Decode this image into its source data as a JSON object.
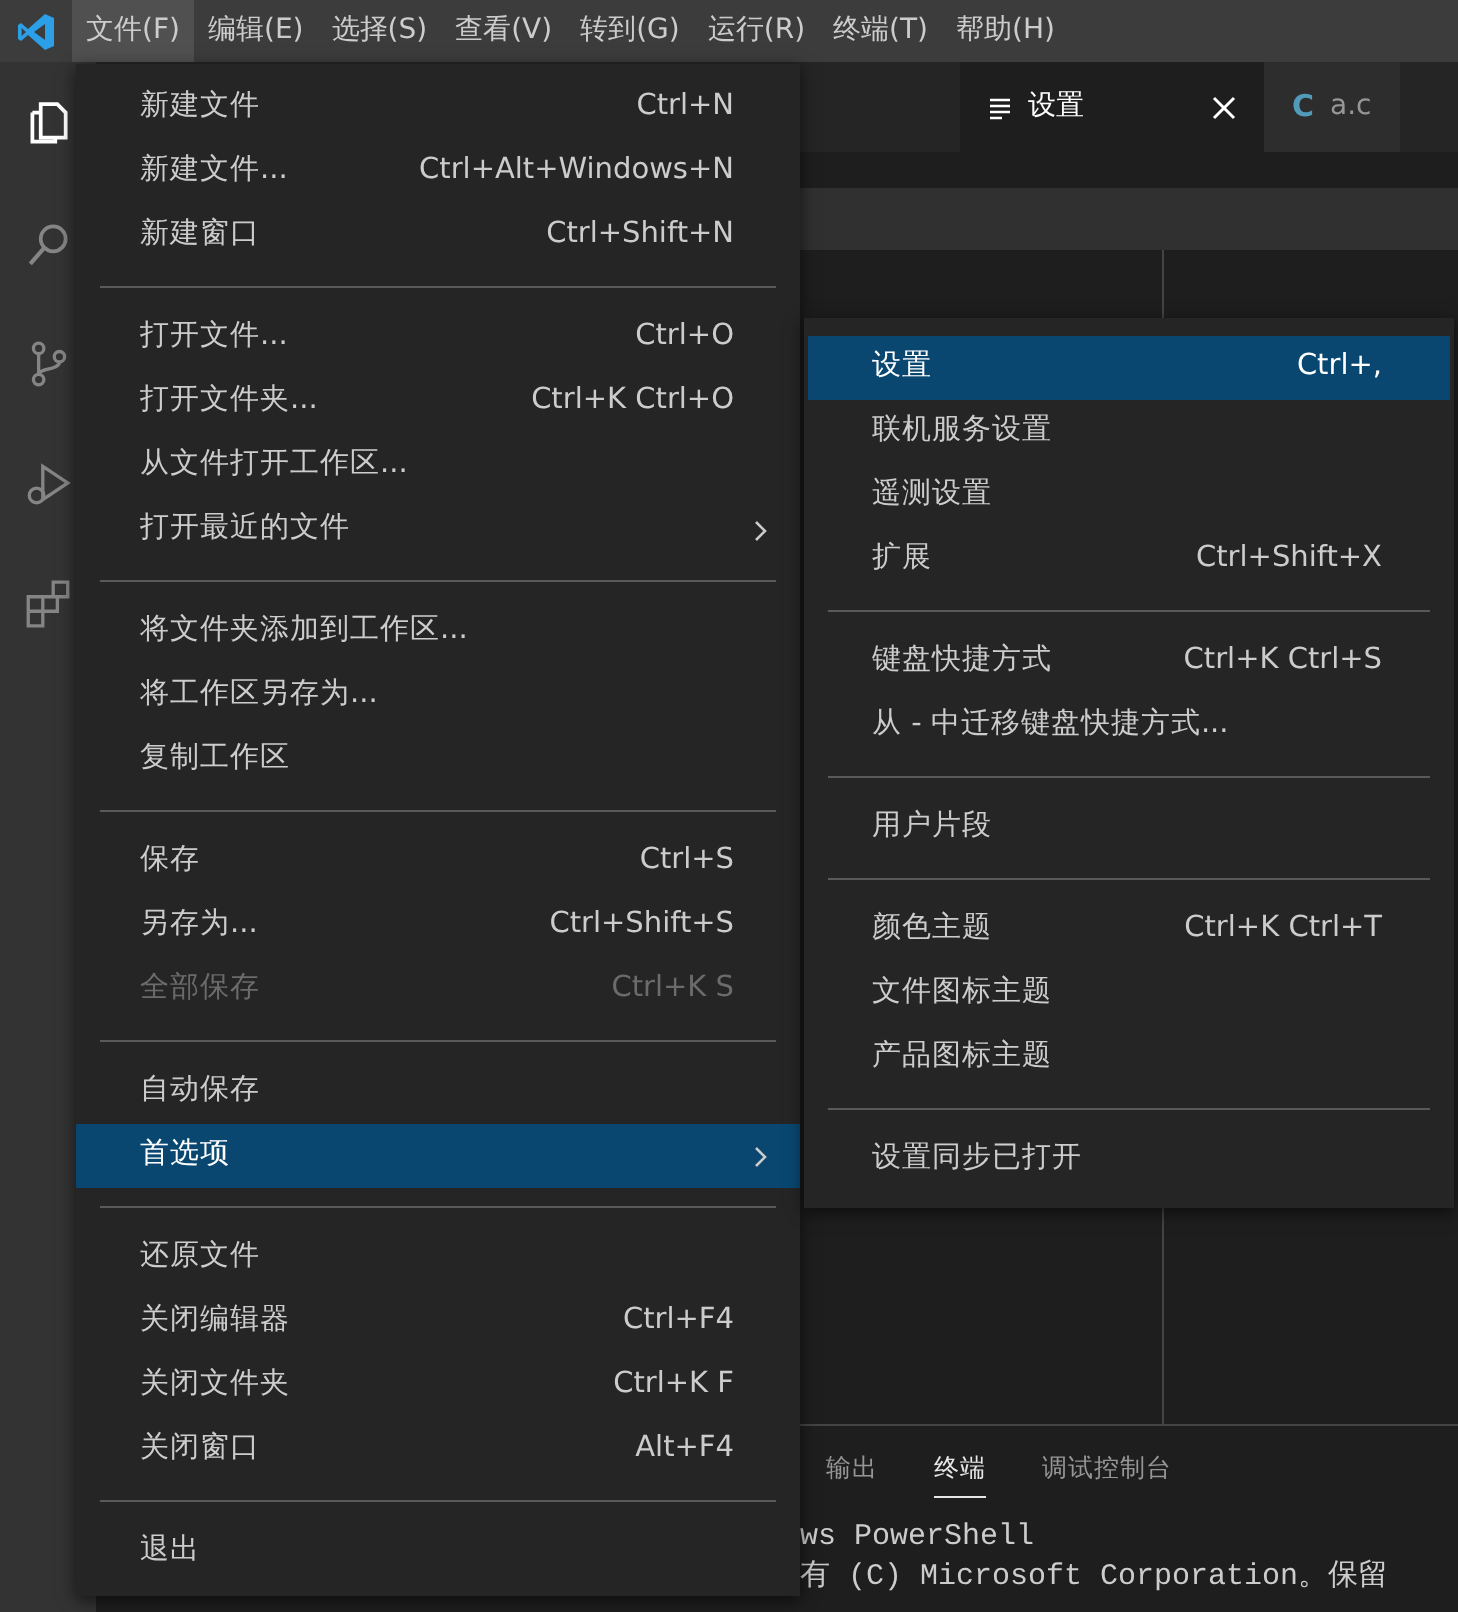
{
  "menubar": [
    {
      "label": "文件(F)",
      "selected": true
    },
    {
      "label": "编辑(E)",
      "selected": false
    },
    {
      "label": "选择(S)",
      "selected": false
    },
    {
      "label": "查看(V)",
      "selected": false
    },
    {
      "label": "转到(G)",
      "selected": false
    },
    {
      "label": "运行(R)",
      "selected": false
    },
    {
      "label": "终端(T)",
      "selected": false
    },
    {
      "label": "帮助(H)",
      "selected": false
    }
  ],
  "activity_bar": [
    {
      "kind": "files",
      "selected": true
    },
    {
      "kind": "search",
      "selected": false
    },
    {
      "kind": "source_control",
      "selected": false
    },
    {
      "kind": "debug",
      "selected": false
    },
    {
      "kind": "extensions",
      "selected": false
    }
  ],
  "editor_tabs": [
    {
      "kind": "settings",
      "label": "设置",
      "selected": true
    },
    {
      "kind": "c_file",
      "icon_text": "C",
      "label": "a.c",
      "selected": false
    }
  ],
  "file_menu": [
    {
      "kind": "item",
      "label": "新建文件",
      "shortcut": "Ctrl+N",
      "disabled": false,
      "selected": false,
      "submenu": false
    },
    {
      "kind": "item",
      "label": "新建文件...",
      "shortcut": "Ctrl+Alt+Windows+N",
      "disabled": false,
      "selected": false,
      "submenu": false
    },
    {
      "kind": "item",
      "label": "新建窗口",
      "shortcut": "Ctrl+Shift+N",
      "disabled": false,
      "selected": false,
      "submenu": false
    },
    {
      "kind": "separator"
    },
    {
      "kind": "item",
      "label": "打开文件...",
      "shortcut": "Ctrl+O",
      "disabled": false,
      "selected": false,
      "submenu": false
    },
    {
      "kind": "item",
      "label": "打开文件夹...",
      "shortcut": "Ctrl+K Ctrl+O",
      "disabled": false,
      "selected": false,
      "submenu": false
    },
    {
      "kind": "item",
      "label": "从文件打开工作区...",
      "disabled": false,
      "selected": false,
      "submenu": false
    },
    {
      "kind": "item",
      "label": "打开最近的文件",
      "disabled": false,
      "selected": false,
      "submenu": true
    },
    {
      "kind": "separator"
    },
    {
      "kind": "item",
      "label": "将文件夹添加到工作区...",
      "disabled": false,
      "selected": false,
      "submenu": false
    },
    {
      "kind": "item",
      "label": "将工作区另存为...",
      "disabled": false,
      "selected": false,
      "submenu": false
    },
    {
      "kind": "item",
      "label": "复制工作区",
      "disabled": false,
      "selected": false,
      "submenu": false
    },
    {
      "kind": "separator"
    },
    {
      "kind": "item",
      "label": "保存",
      "shortcut": "Ctrl+S",
      "disabled": false,
      "selected": false,
      "submenu": false
    },
    {
      "kind": "item",
      "label": "另存为...",
      "shortcut": "Ctrl+Shift+S",
      "disabled": false,
      "selected": false,
      "submenu": false
    },
    {
      "kind": "item",
      "label": "全部保存",
      "shortcut": "Ctrl+K S",
      "disabled": true,
      "selected": false,
      "submenu": false
    },
    {
      "kind": "separator"
    },
    {
      "kind": "item",
      "label": "自动保存",
      "disabled": false,
      "selected": false,
      "submenu": false
    },
    {
      "kind": "item",
      "label": "首选项",
      "disabled": false,
      "selected": true,
      "submenu": true
    },
    {
      "kind": "separator"
    },
    {
      "kind": "item",
      "label": "还原文件",
      "disabled": false,
      "selected": false,
      "submenu": false
    },
    {
      "kind": "item",
      "label": "关闭编辑器",
      "shortcut": "Ctrl+F4",
      "disabled": false,
      "selected": false,
      "submenu": false
    },
    {
      "kind": "item",
      "label": "关闭文件夹",
      "shortcut": "Ctrl+K F",
      "disabled": false,
      "selected": false,
      "submenu": false
    },
    {
      "kind": "item",
      "label": "关闭窗口",
      "shortcut": "Alt+F4",
      "disabled": false,
      "selected": false,
      "submenu": false
    },
    {
      "kind": "separator"
    },
    {
      "kind": "item",
      "label": "退出",
      "disabled": false,
      "selected": false,
      "submenu": false
    }
  ],
  "preferences_submenu": [
    {
      "kind": "item",
      "label": "设置",
      "shortcut": "Ctrl+,",
      "selected": true
    },
    {
      "kind": "item",
      "label": "联机服务设置",
      "selected": false
    },
    {
      "kind": "item",
      "label": "遥测设置",
      "selected": false
    },
    {
      "kind": "item",
      "label": "扩展",
      "shortcut": "Ctrl+Shift+X",
      "selected": false
    },
    {
      "kind": "separator"
    },
    {
      "kind": "item",
      "label": "键盘快捷方式",
      "shortcut": "Ctrl+K Ctrl+S",
      "selected": false
    },
    {
      "kind": "item",
      "label": "从 - 中迁移键盘快捷方式...",
      "selected": false
    },
    {
      "kind": "separator"
    },
    {
      "kind": "item",
      "label": "用户片段",
      "selected": false
    },
    {
      "kind": "separator"
    },
    {
      "kind": "item",
      "label": "颜色主题",
      "shortcut": "Ctrl+K Ctrl+T",
      "selected": false
    },
    {
      "kind": "item",
      "label": "文件图标主题",
      "selected": false
    },
    {
      "kind": "item",
      "label": "产品图标主题",
      "selected": false
    },
    {
      "kind": "separator"
    },
    {
      "kind": "item",
      "label": "设置同步已打开",
      "selected": false
    }
  ],
  "panel": {
    "tabs": [
      {
        "label": "输出",
        "selected": false
      },
      {
        "label": "终端",
        "selected": true
      },
      {
        "label": "调试控制台",
        "selected": false
      }
    ],
    "terminal_lines": [
      "ws PowerShell",
      "有 (C) Microsoft Corporation。保留"
    ]
  }
}
